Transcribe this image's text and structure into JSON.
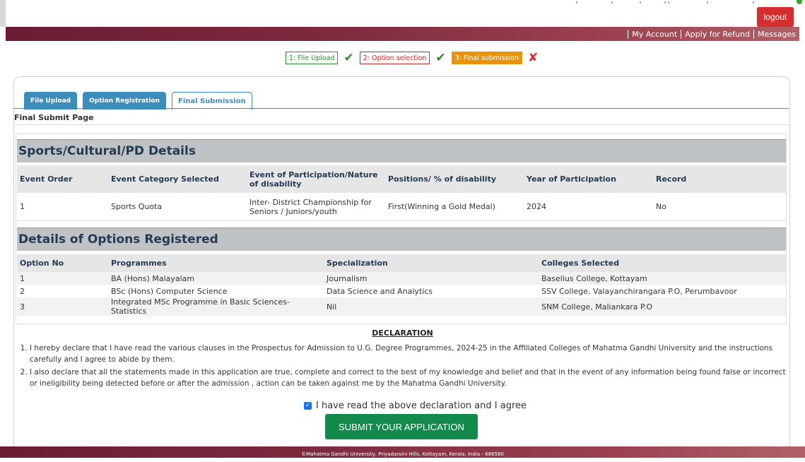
{
  "header": {
    "logout_label": "logout",
    "nav": [
      "My Account",
      "Apply for Refund",
      "Messages"
    ]
  },
  "steps": {
    "step1": "1: File Upload",
    "step2": "2: Option selection",
    "step3": "3: Final submission"
  },
  "tabs": [
    "File Upload",
    "Option Registration",
    "Final Submission"
  ],
  "page_label": "Final Submit Page",
  "sports": {
    "title": "Sports/Cultural/PD Details",
    "headers": [
      "Event Order",
      "Event Category Selected",
      "Event of Participation/Nature of disability",
      "Positions/ % of disability",
      "Year of Participation",
      "Record"
    ],
    "rows": [
      [
        "1",
        "Sports Quota",
        "Inter- District Championship for Seniors / Juniors/youth",
        "First(Winning a Gold Medal)",
        "2024",
        "No"
      ]
    ]
  },
  "options": {
    "title": "Details of Options Registered",
    "headers": [
      "Option No",
      "Programmes",
      "Specialization",
      "Colleges Selected"
    ],
    "rows": [
      [
        "1",
        "BA (Hons) Malayalam",
        "Journalism",
        "Baselius College, Kottayam"
      ],
      [
        "2",
        "BSc (Hons) Computer Science",
        "Data Science and Analytics",
        "SSV College, Valayanchirangara P.O, Perumbavoor"
      ],
      [
        "3",
        "Integrated MSc Programme in Basic Sciences-Statistics",
        "Nil",
        "SNM College, Maliankara P.O"
      ]
    ]
  },
  "declaration": {
    "title": "DECLARATION",
    "items": [
      "I hereby declare that I have read the various clauses in the Prospectus for Admission to U.G. Degree Programmes, 2024-25 in the Affiliated Colleges of Mahatma Gandhi University and the instructions carefully and I agree to abide by them.",
      "I also declare that all the statements made in this application are true, complete and correct to the best of my knowledge and belief and that in the event of any information being found false or incorrect or ineligibility being detected before or after the admission , action can be taken against me by the Mahatma Gandhi University."
    ],
    "agree_label": "I have read the above declaration and I agree",
    "agree_checked": true
  },
  "submit_label": "SUBMIT YOUR APPLICATION",
  "footer": "©Mahatma Gandhi University, Priyadarsini Hills, Kottayam, Kerala, India - 686560"
}
